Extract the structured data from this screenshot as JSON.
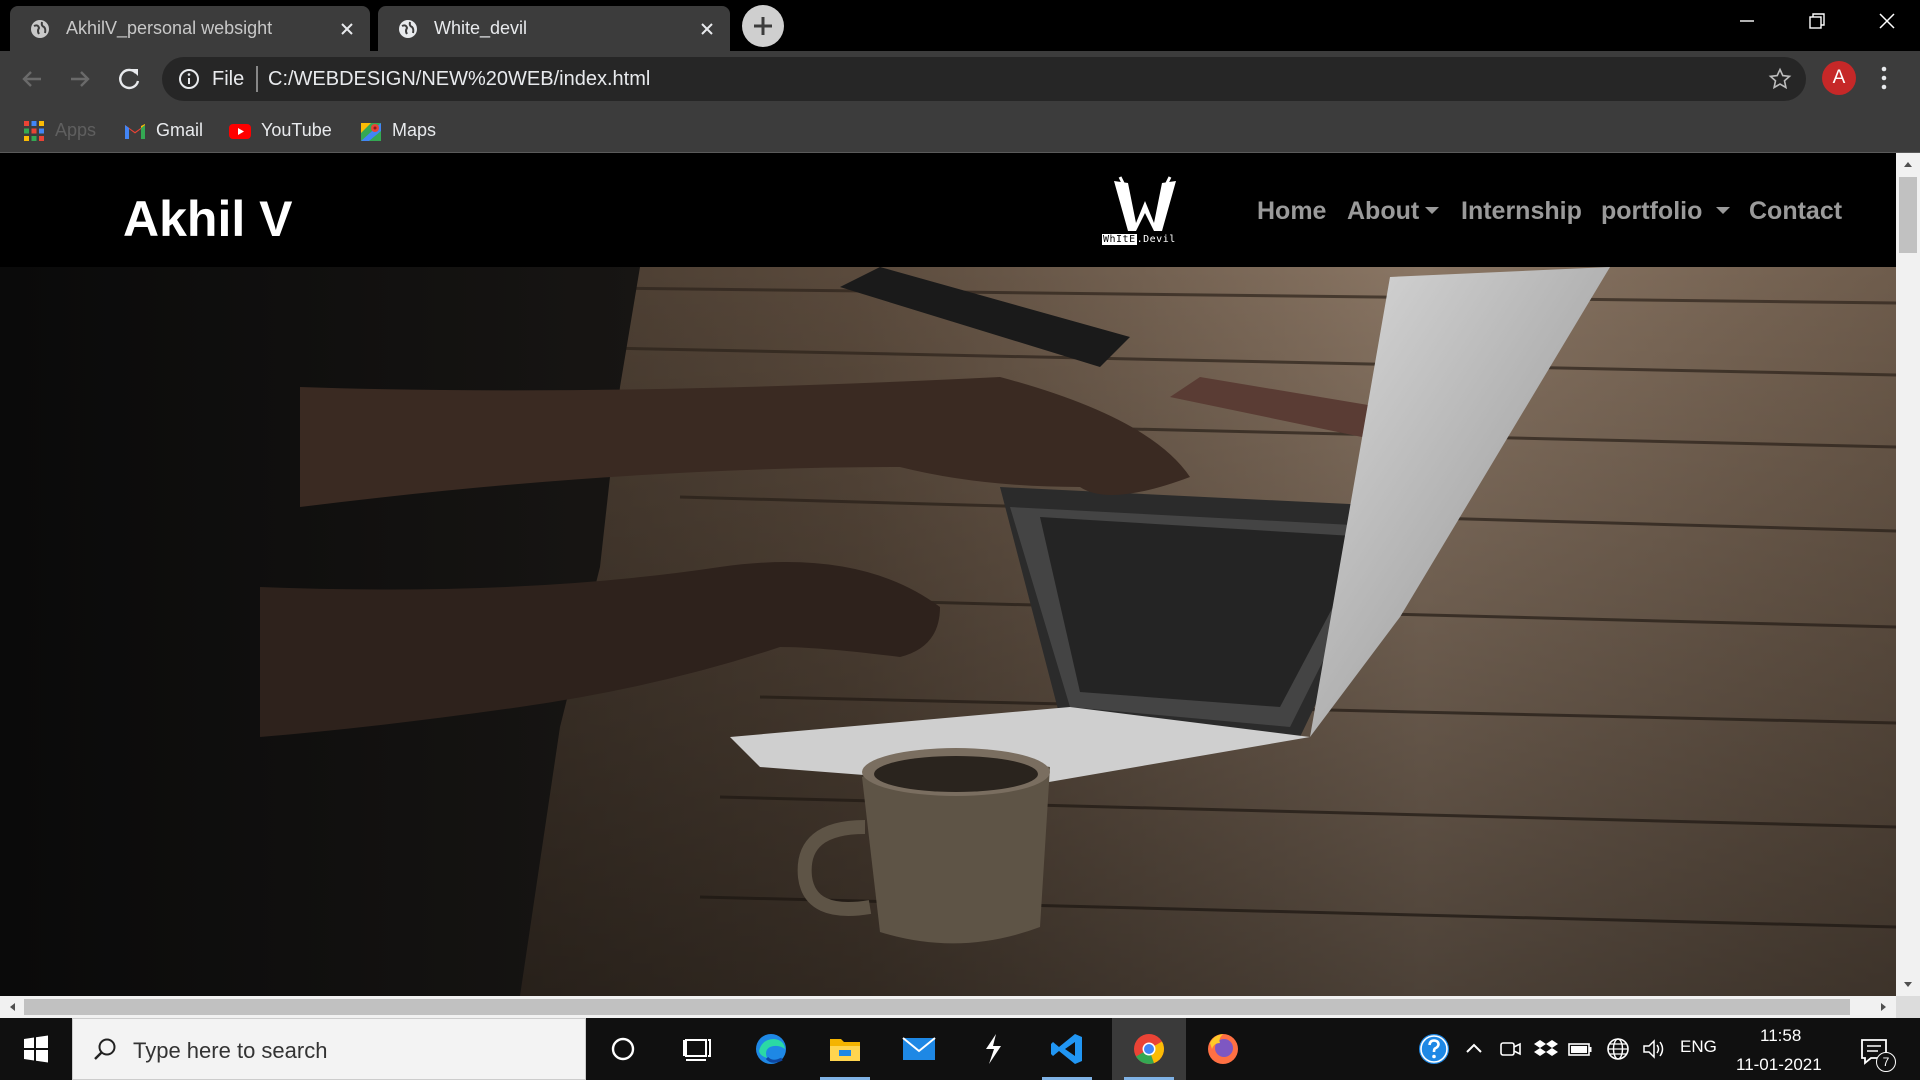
{
  "browser": {
    "tabs": [
      {
        "title": "AkhilV_personal websight",
        "active": false
      },
      {
        "title": "White_devil",
        "active": true
      }
    ],
    "address": {
      "scheme_label": "File",
      "url": "C:/WEBDESIGN/NEW%20WEB/index.html"
    },
    "profile_initial": "A",
    "bookmarks": [
      {
        "label": "Apps",
        "icon": "apps-grid-icon"
      },
      {
        "label": "Gmail",
        "icon": "gmail-icon"
      },
      {
        "label": "YouTube",
        "icon": "youtube-icon"
      },
      {
        "label": "Maps",
        "icon": "maps-icon"
      }
    ]
  },
  "site": {
    "brand": "Akhil V",
    "logo": {
      "word1": "WhItE",
      "word2": ".Devil"
    },
    "nav": [
      {
        "label": "Home",
        "dropdown": false
      },
      {
        "label": "About",
        "dropdown": true
      },
      {
        "label": "Internship",
        "dropdown": false
      },
      {
        "label": "portfolio",
        "dropdown": true
      },
      {
        "label": "Contact",
        "dropdown": false
      }
    ],
    "hero_image": "person typing on laptop at wooden desk with coffee mug"
  },
  "taskbar": {
    "search_placeholder": "Type here to search",
    "pinned": [
      "cortana-icon",
      "task-view-icon",
      "edge-icon",
      "file-explorer-icon",
      "mail-icon",
      "app-icon",
      "vscode-icon",
      "chrome-icon",
      "firefox-icon"
    ],
    "language": "ENG",
    "time": "11:58",
    "date": "11-01-2021",
    "notification_count": "7"
  },
  "colors": {
    "accent_chrome_profile": "#c62828",
    "site_nav_bg": "#000000",
    "nav_link": "#9a9a9a"
  }
}
